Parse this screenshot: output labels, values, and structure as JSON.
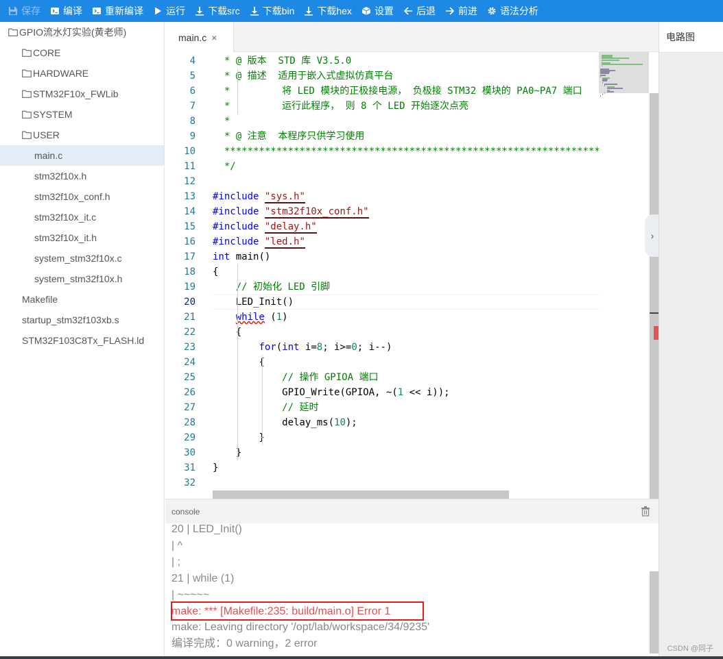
{
  "toolbar": {
    "items": [
      {
        "label": "保存",
        "icon": "save-icon",
        "disabled": true
      },
      {
        "label": "编译",
        "icon": "compile-icon"
      },
      {
        "label": "重新编译",
        "icon": "rebuild-icon"
      },
      {
        "label": "运行",
        "icon": "play-icon"
      },
      {
        "label": "下载src",
        "icon": "download-icon"
      },
      {
        "label": "下载bin",
        "icon": "download-icon"
      },
      {
        "label": "下载hex",
        "icon": "download-icon"
      },
      {
        "label": "设置",
        "icon": "cube-icon"
      },
      {
        "label": "后退",
        "icon": "arrow-left-icon"
      },
      {
        "label": "前进",
        "icon": "arrow-right-icon"
      },
      {
        "label": "语法分析",
        "icon": "gear-icon"
      }
    ]
  },
  "sidebar": {
    "items": [
      {
        "label": "GPIO流水灯实验(黄老师)",
        "folder": true,
        "level": 0
      },
      {
        "label": "CORE",
        "folder": true,
        "level": 1
      },
      {
        "label": "HARDWARE",
        "folder": true,
        "level": 1
      },
      {
        "label": "STM32F10x_FWLib",
        "folder": true,
        "level": 1
      },
      {
        "label": "SYSTEM",
        "folder": true,
        "level": 1
      },
      {
        "label": "USER",
        "folder": true,
        "level": 1
      },
      {
        "label": "main.c",
        "folder": false,
        "level": 2,
        "active": true
      },
      {
        "label": "stm32f10x.h",
        "folder": false,
        "level": 2
      },
      {
        "label": "stm32f10x_conf.h",
        "folder": false,
        "level": 2
      },
      {
        "label": "stm32f10x_it.c",
        "folder": false,
        "level": 2
      },
      {
        "label": "stm32f10x_it.h",
        "folder": false,
        "level": 2
      },
      {
        "label": "system_stm32f10x.c",
        "folder": false,
        "level": 2
      },
      {
        "label": "system_stm32f10x.h",
        "folder": false,
        "level": 2
      },
      {
        "label": "Makefile",
        "folder": false,
        "level": 1
      },
      {
        "label": "startup_stm32f103xb.s",
        "folder": false,
        "level": 1
      },
      {
        "label": "STM32F103C8Tx_FLASH.ld",
        "folder": false,
        "level": 1
      }
    ]
  },
  "editor": {
    "tab_label": "main.c",
    "tab_close": "×",
    "current_line": 20,
    "lines": [
      {
        "no": "4",
        "segs": [
          [
            "cm",
            "  * @ 版本  STD 库 V3.5.0"
          ]
        ]
      },
      {
        "no": "5",
        "segs": [
          [
            "cm",
            "  * @ 描述  适用于嵌入式虚拟仿真平台"
          ]
        ]
      },
      {
        "no": "6",
        "segs": [
          [
            "cm",
            "  *         将 LED 模块的正极接电源， 负极接 STM32 模块的 PA0~PA7 端口"
          ]
        ]
      },
      {
        "no": "7",
        "segs": [
          [
            "cm",
            "  *         运行此程序， 则 8 个 LED 开始逐次点亮"
          ]
        ]
      },
      {
        "no": "8",
        "segs": [
          [
            "cm",
            "  *"
          ]
        ]
      },
      {
        "no": "9",
        "segs": [
          [
            "cm",
            "  * @ 注意  本程序只供学习使用"
          ]
        ]
      },
      {
        "no": "10",
        "segs": [
          [
            "cm",
            "  ******************************************************************************"
          ]
        ]
      },
      {
        "no": "11",
        "segs": [
          [
            "cm",
            "  */"
          ]
        ]
      },
      {
        "no": "12",
        "segs": []
      },
      {
        "no": "13",
        "segs": [
          [
            "kw",
            "#include "
          ],
          [
            "str incl",
            "\"sys.h\""
          ]
        ]
      },
      {
        "no": "14",
        "segs": [
          [
            "kw",
            "#include "
          ],
          [
            "str incl",
            "\"stm32f10x_conf.h\""
          ]
        ]
      },
      {
        "no": "15",
        "segs": [
          [
            "kw",
            "#include "
          ],
          [
            "str incl",
            "\"delay.h\""
          ]
        ]
      },
      {
        "no": "16",
        "segs": [
          [
            "kw",
            "#include "
          ],
          [
            "str incl",
            "\"led.h\""
          ]
        ]
      },
      {
        "no": "17",
        "segs": [
          [
            "kw",
            "int"
          ],
          [
            "",
            " main()"
          ]
        ]
      },
      {
        "no": "18",
        "segs": [
          [
            "",
            "{"
          ]
        ]
      },
      {
        "no": "19",
        "segs": [
          [
            "",
            "    "
          ],
          [
            "cm",
            "// 初始化 LED 引脚"
          ]
        ]
      },
      {
        "no": "20",
        "segs": [
          [
            "",
            "    LED_Init()"
          ]
        ]
      },
      {
        "no": "21",
        "segs": [
          [
            "",
            "    "
          ],
          [
            "kw squig",
            "while"
          ],
          [
            "",
            " ("
          ],
          [
            "num",
            "1"
          ],
          [
            "",
            ")"
          ]
        ]
      },
      {
        "no": "22",
        "segs": [
          [
            "",
            "    {"
          ]
        ]
      },
      {
        "no": "23",
        "segs": [
          [
            "",
            "        "
          ],
          [
            "kw",
            "for"
          ],
          [
            "",
            "("
          ],
          [
            "kw",
            "int"
          ],
          [
            "",
            " i="
          ],
          [
            "num",
            "8"
          ],
          [
            "",
            "; i>="
          ],
          [
            "num",
            "0"
          ],
          [
            "",
            "; i--)"
          ]
        ]
      },
      {
        "no": "24",
        "segs": [
          [
            "",
            "        {"
          ]
        ]
      },
      {
        "no": "25",
        "segs": [
          [
            "",
            "            "
          ],
          [
            "cm",
            "// 操作 GPIOA 端口"
          ]
        ]
      },
      {
        "no": "26",
        "segs": [
          [
            "",
            "            GPIO_Write(GPIOA, ~("
          ],
          [
            "num",
            "1"
          ],
          [
            "",
            " << i));"
          ]
        ]
      },
      {
        "no": "27",
        "segs": [
          [
            "",
            "            "
          ],
          [
            "cm",
            "// 延时"
          ]
        ]
      },
      {
        "no": "28",
        "segs": [
          [
            "",
            "            delay_ms("
          ],
          [
            "num",
            "10"
          ],
          [
            "",
            ");"
          ]
        ]
      },
      {
        "no": "29",
        "segs": [
          [
            "",
            "        }"
          ]
        ]
      },
      {
        "no": "30",
        "segs": [
          [
            "",
            "    }"
          ]
        ]
      },
      {
        "no": "31",
        "segs": [
          [
            "",
            "}"
          ]
        ]
      },
      {
        "no": "32",
        "segs": []
      }
    ]
  },
  "console": {
    "title": "console",
    "lines": [
      {
        "text": "20 | LED_Init()",
        "error": false
      },
      {
        "text": "| ^",
        "error": false
      },
      {
        "text": "| ;",
        "error": false
      },
      {
        "text": "21 | while (1)",
        "error": false
      },
      {
        "text": "| ~~~~~",
        "error": false
      },
      {
        "text": "make: *** [Makefile:235: build/main.o] Error 1",
        "error": true
      },
      {
        "text": "make: Leaving directory '/opt/lab/workspace/34/9235'",
        "error": false
      },
      {
        "text": "编译完成：0 warning，2 error",
        "error": false
      }
    ]
  },
  "right_panel": {
    "title": "电路图",
    "watermark": "CSDN @同子"
  },
  "colors": {
    "toolbar_bg": "#1e88e5",
    "active_file_bg": "#e4ecf6",
    "error_text": "#e05050",
    "error_box": "#e21b1b"
  }
}
